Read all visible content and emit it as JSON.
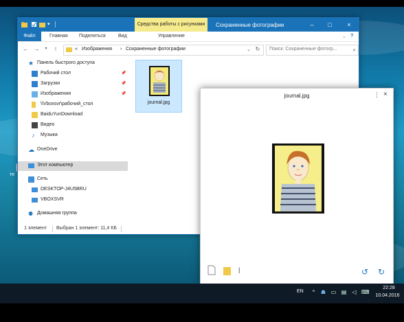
{
  "explorer": {
    "context_tab": "Средства работы с рисунками",
    "title": "Сохраненные фотографии",
    "ribbon_tabs": {
      "file": "Файл",
      "home": "Главная",
      "share": "Поделиться",
      "view": "Вид",
      "manage": "Управление"
    },
    "address": {
      "overflow": "«",
      "crumb1": "Изображения",
      "separator": "›",
      "crumb2": "Сохраненные фотографии"
    },
    "search_placeholder": "Поиск: Сохраненные фотогр...",
    "nav": {
      "quick_access": "Панель быстрого доступа",
      "desktop": "Рабочий стол",
      "downloads": "Загрузки",
      "pictures": "Изображения",
      "vbox_desktop": "\\\\Vboxsvr\\рабочий_стол",
      "baidu": "BaiduYunDownload",
      "video": "Видео",
      "music": "Музыка",
      "onedrive": "OneDrive",
      "this_pc": "Этот компьютер",
      "network": "Сеть",
      "desktop_pc": "DESKTOP-J4U5BRU",
      "vboxsvr": "VBOXSVR",
      "homegroup": "Домашняя группа"
    },
    "file": {
      "name": "journal.jpg"
    },
    "status": {
      "count": "1 элемент",
      "selected": "Выбран 1 элемент: 11,4 КБ"
    }
  },
  "viewer": {
    "title": "journal.jpg",
    "more": "⋮",
    "close": "×",
    "cursor": "|"
  },
  "desktop": {
    "label": "тe"
  },
  "taskbar": {
    "lang": "EN",
    "time": "22:28",
    "date": "10.04.2016"
  },
  "colors": {
    "accent": "#1a73b8",
    "context_tab": "#f6eb8c",
    "selection": "#cce8ff"
  }
}
